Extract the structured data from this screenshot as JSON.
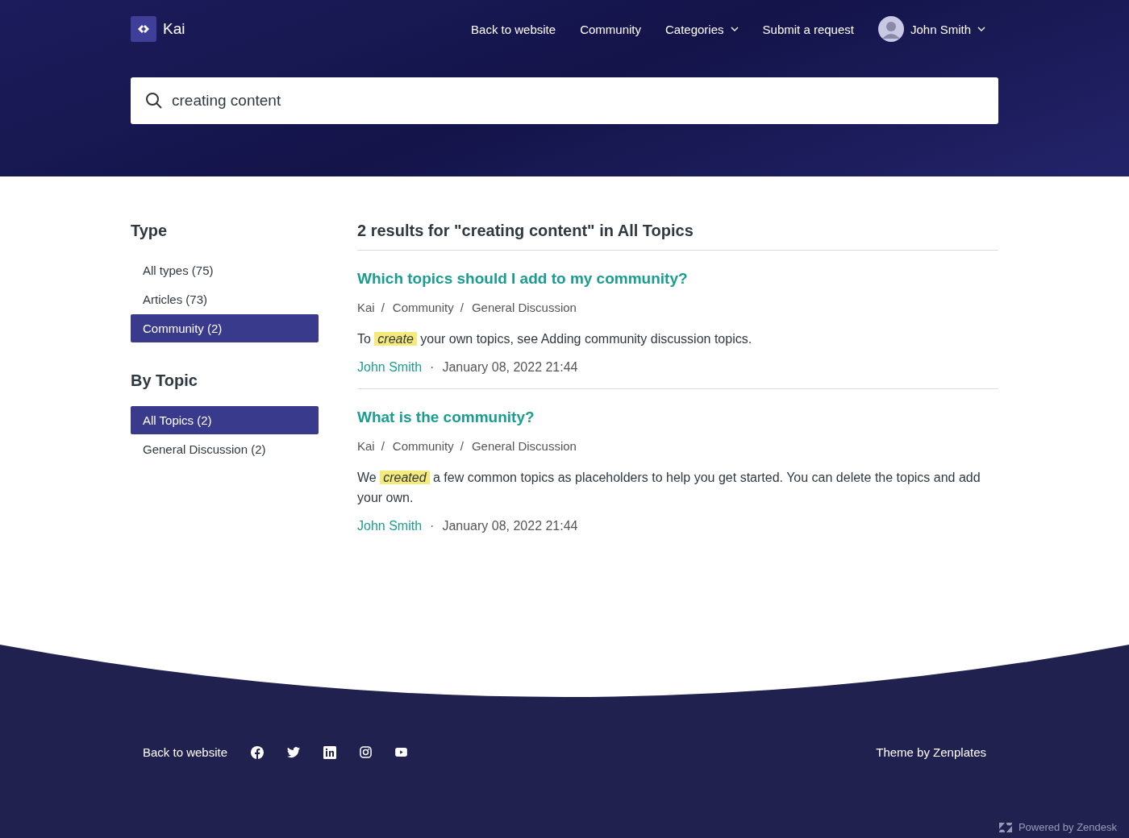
{
  "brand": {
    "name": "Kai"
  },
  "nav": [
    {
      "label": "Back to website",
      "dropdown": false
    },
    {
      "label": "Community",
      "dropdown": false
    },
    {
      "label": "Categories",
      "dropdown": true
    },
    {
      "label": "Submit a request",
      "dropdown": false
    }
  ],
  "user": {
    "name": "John Smith",
    "dropdown": true
  },
  "search": {
    "value": "creating content"
  },
  "sidebar": [
    {
      "title": "Type",
      "items": [
        {
          "label": "All types (75)",
          "selected": false
        },
        {
          "label": "Articles (73)",
          "selected": false
        },
        {
          "label": "Community (2)",
          "selected": true
        }
      ]
    },
    {
      "title": "By Topic",
      "items": [
        {
          "label": "All Topics (2)",
          "selected": true
        },
        {
          "label": "General Discussion (2)",
          "selected": false
        }
      ]
    }
  ],
  "results_heading": "2 results for \"creating content\" in All Topics",
  "results": [
    {
      "title": "Which topics should I add to my community?",
      "breadcrumb": [
        "Kai",
        "Community",
        "General Discussion"
      ],
      "separators": [
        "/",
        "/"
      ],
      "excerpt": [
        {
          "text": "To ",
          "highlighted": false
        },
        {
          "text": "create",
          "highlighted": true
        },
        {
          "text": " your own topics, see Adding community discussion topics.",
          "highlighted": false
        }
      ],
      "author": "John Smith",
      "dot": "·",
      "date": "January 08, 2022 21:44"
    },
    {
      "title": "What is the community?",
      "breadcrumb": [
        "Kai",
        "Community",
        "General Discussion"
      ],
      "separators": [
        "/",
        "/"
      ],
      "excerpt": [
        {
          "text": "We ",
          "highlighted": false
        },
        {
          "text": "created",
          "highlighted": true
        },
        {
          "text": " a few common topics as placeholders to help you get started. You can delete the topics and add your own.",
          "highlighted": false
        }
      ],
      "author": "John Smith",
      "dot": "·",
      "date": "January 08, 2022 21:44"
    }
  ],
  "footer": {
    "link": "Back to website",
    "social": [
      {
        "kind": "facebook"
      },
      {
        "kind": "twitter"
      },
      {
        "kind": "linkedin"
      },
      {
        "kind": "instagram"
      },
      {
        "kind": "youtube"
      }
    ],
    "credit": "Theme by Zenplates",
    "powered": "Powered by Zendesk"
  }
}
